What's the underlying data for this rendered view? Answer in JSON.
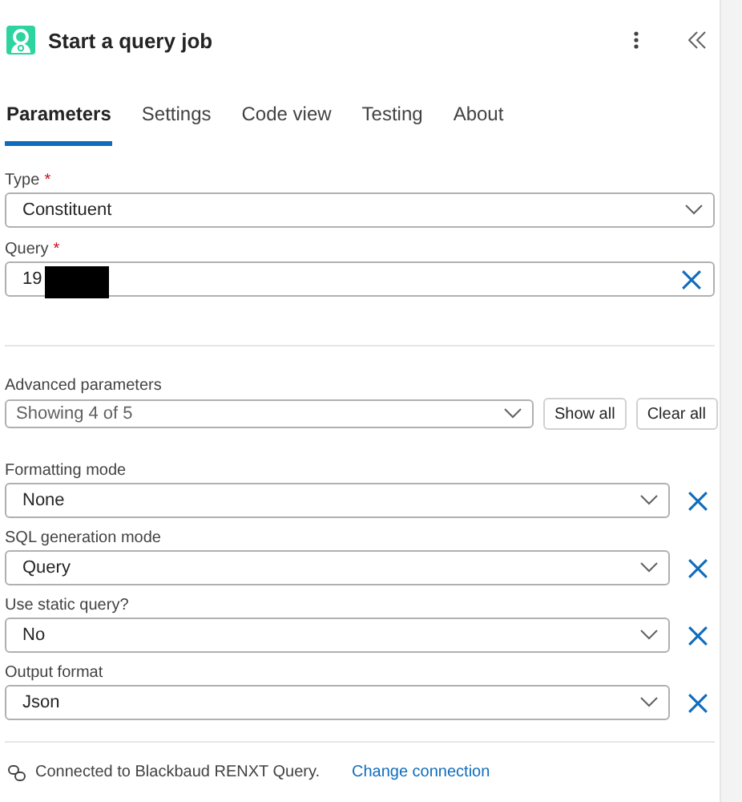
{
  "header": {
    "title": "Start a query job"
  },
  "tabs": [
    {
      "label": "Parameters",
      "selected": true
    },
    {
      "label": "Settings",
      "selected": false
    },
    {
      "label": "Code view",
      "selected": false
    },
    {
      "label": "Testing",
      "selected": false
    },
    {
      "label": "About",
      "selected": false
    }
  ],
  "parameters": [
    {
      "kind": "dropdown",
      "label": "Type",
      "required_marker": "*",
      "value": "Constituent"
    },
    {
      "kind": "text",
      "label": "Query",
      "required_marker": "*",
      "value": "19",
      "redacted": true
    }
  ],
  "advanced": {
    "label": "Advanced parameters",
    "summary": "Showing 4 of 5",
    "buttons": [
      "Show all",
      "Clear all"
    ]
  },
  "advanced_parameters": [
    {
      "label": "Formatting mode",
      "value": "None"
    },
    {
      "label": "SQL generation mode",
      "value": "Query"
    },
    {
      "label": "Use static query?",
      "value": "No"
    },
    {
      "label": "Output format",
      "value": "Json"
    }
  ],
  "footer": {
    "connection": "Connected to Blackbaud RENXT Query.",
    "link": "Change connection"
  }
}
